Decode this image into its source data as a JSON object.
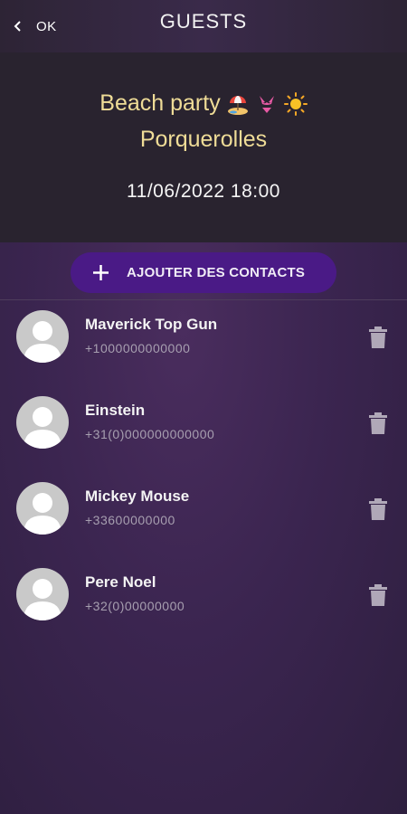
{
  "topbar": {
    "back_label": "OK",
    "title": "GUESTS"
  },
  "event": {
    "name": "Beach party",
    "emojis": [
      "beach-umbrella-emoji",
      "bikini-emoji",
      "sun-emoji"
    ],
    "place": "Porquerolles",
    "datetime": "11/06/2022 18:00"
  },
  "add_contacts": {
    "label": "AJOUTER DES CONTACTS",
    "icon": "plus-icon"
  },
  "contacts": [
    {
      "name": "Maverick Top Gun",
      "phone": "+1000000000000"
    },
    {
      "name": "Einstein",
      "phone": "+31(0)000000000000"
    },
    {
      "name": "Mickey Mouse",
      "phone": "+33600000000"
    },
    {
      "name": "Pere Noel",
      "phone": "+32(0)00000000"
    }
  ],
  "colors": {
    "accent": "#4a1a86",
    "event_text": "#efdc97",
    "header_bg": "#29232f"
  }
}
